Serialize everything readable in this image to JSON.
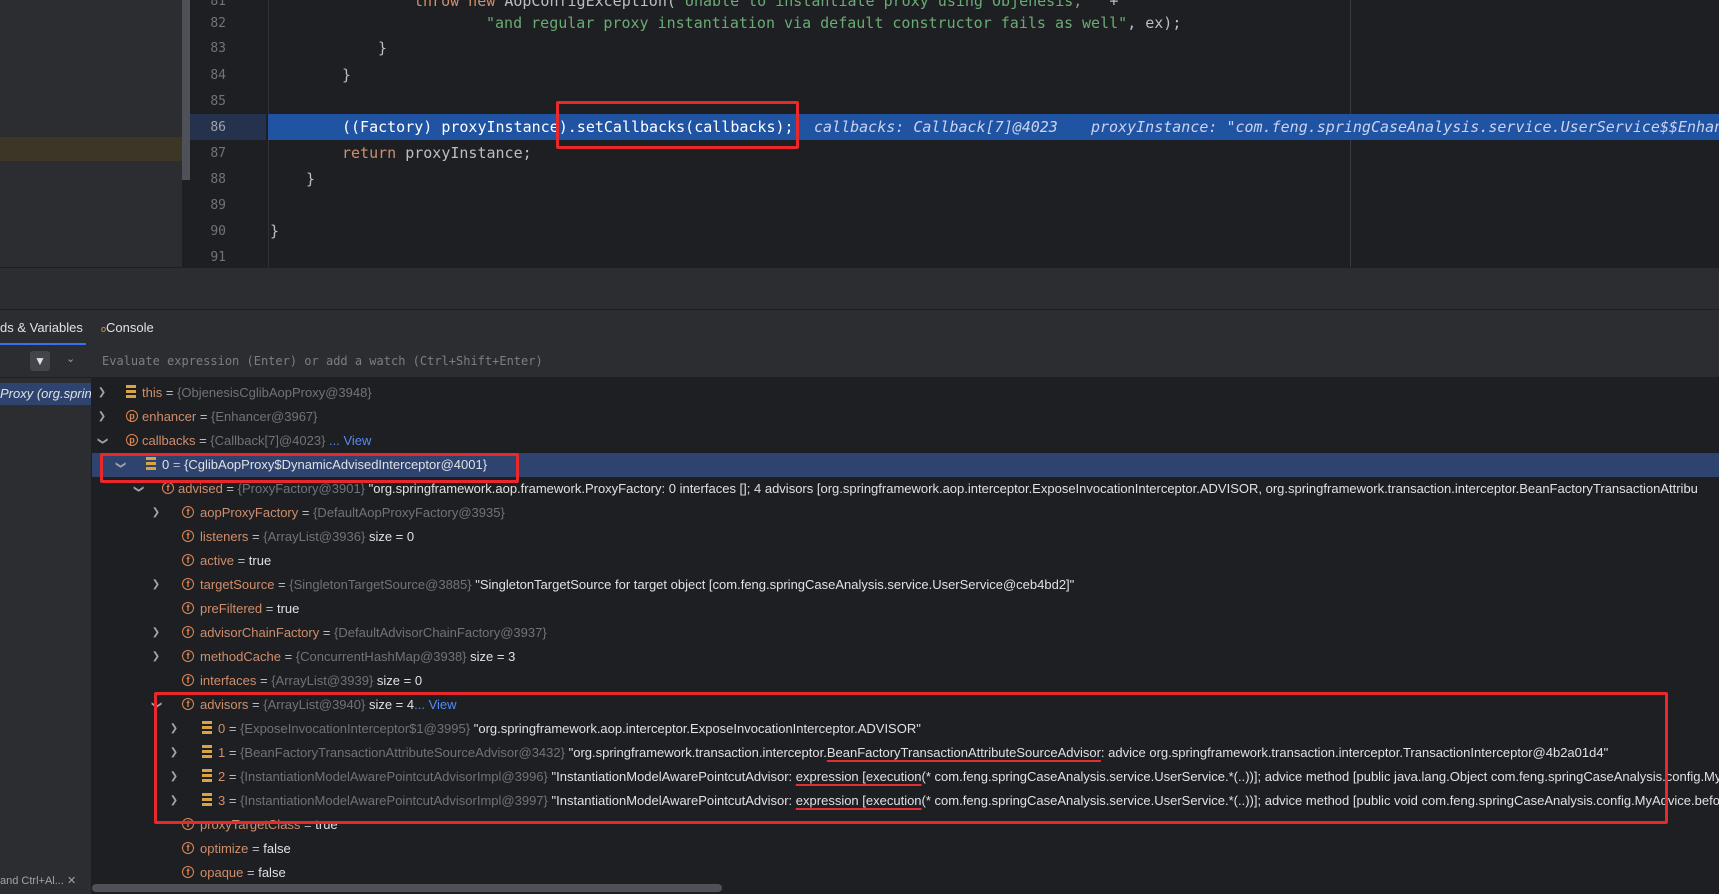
{
  "editor": {
    "lines": [
      {
        "num": "81",
        "text": "throw new AopConfigException(\"Unable to instantiate proxy using Objenesis, \" +"
      },
      {
        "num": "82",
        "text": "\"and regular proxy instantiation via default constructor fails as well\", ex);"
      },
      {
        "num": "83",
        "text": "}"
      },
      {
        "num": "84",
        "text": "}"
      },
      {
        "num": "85",
        "text": ""
      },
      {
        "num": "86",
        "text": "((Factory) proxyInstance).setCallbacks(callbacks);"
      },
      {
        "num": "87",
        "text": "return proxyInstance;"
      },
      {
        "num": "88",
        "text": "}"
      },
      {
        "num": "89",
        "text": ""
      },
      {
        "num": "90",
        "text": "}"
      },
      {
        "num": "91",
        "text": ""
      }
    ],
    "code_81_kw": "throw new ",
    "code_81_rest": "AopConfigException(",
    "code_81_str": "\"Unable to instantiate proxy using Objenesis, \"",
    "code_81_tail": " +",
    "code_82_str": "\"and regular proxy instantiation via default constructor fails as well\"",
    "code_82_tail": ", ex);",
    "code_86_a": "((Factory) proxyInstance)",
    "code_86_b": ".setCallbacks(callbacks);",
    "code_87_kw": "return",
    "code_87_rest": " proxyInstance;",
    "hint_callbacks": "callbacks: Callback[7]@4023",
    "hint_proxy": "proxyInstance: \"com.feng.springCaseAnalysis.service.UserService$$Enhan"
  },
  "tabs": {
    "threads_variables": "ds & Variables",
    "console": "Console"
  },
  "eval": {
    "filter_icon": "filter-icon",
    "placeholder": "Evaluate expression (Enter) or add a watch (Ctrl+Shift+Enter)"
  },
  "frames": {
    "selected": "Proxy (org.sprin",
    "footer": "and Ctrl+Al..."
  },
  "vars": [
    {
      "name": "this",
      "type": "{ObjenesisCglibAopProxy@3948}",
      "value": ""
    },
    {
      "name": "enhancer",
      "type": "{Enhancer@3967}",
      "value": ""
    },
    {
      "name": "callbacks",
      "type": "{Callback[7]@4023}",
      "value": "",
      "link": "... View"
    },
    {
      "name": "0",
      "type": "",
      "value": "{CglibAopProxy$DynamicAdvisedInterceptor@4001}"
    },
    {
      "name": "advised",
      "type": "{ProxyFactory@3901}",
      "value": "\"org.springframework.aop.framework.ProxyFactory: 0 interfaces []; 4 advisors [org.springframework.aop.interceptor.ExposeInvocationInterceptor.ADVISOR, org.springframework.transaction.interceptor.BeanFactoryTransactionAttribu"
    },
    {
      "name": "aopProxyFactory",
      "type": "{DefaultAopProxyFactory@3935}",
      "value": ""
    },
    {
      "name": "listeners",
      "type": "{ArrayList@3936}",
      "value": " size = 0"
    },
    {
      "name": "active",
      "type": "",
      "value": "true"
    },
    {
      "name": "targetSource",
      "type": "{SingletonTargetSource@3885}",
      "value": "\"SingletonTargetSource for target object [com.feng.springCaseAnalysis.service.UserService@ceb4bd2]\""
    },
    {
      "name": "preFiltered",
      "type": "",
      "value": "true"
    },
    {
      "name": "advisorChainFactory",
      "type": "{DefaultAdvisorChainFactory@3937}",
      "value": ""
    },
    {
      "name": "methodCache",
      "type": "{ConcurrentHashMap@3938}",
      "value": " size = 3"
    },
    {
      "name": "interfaces",
      "type": "{ArrayList@3939}",
      "value": " size = 0"
    },
    {
      "name": "advisors",
      "type": "{ArrayList@3940}",
      "value": " size = 4",
      "link": "... View"
    },
    {
      "name": "0",
      "type": "{ExposeInvocationInterceptor$1@3995}",
      "value": "\"org.springframework.aop.interceptor.ExposeInvocationInterceptor.ADVISOR\""
    },
    {
      "name": "1",
      "type": "{BeanFactoryTransactionAttributeSourceAdvisor@3432}",
      "value_a": "\"org.springframework.transaction.interceptor.",
      "value_u": "BeanFactoryTransactionAttributeSourceAdvisor",
      "value_b": ": advice org.springframework.transaction.interceptor.TransactionInterceptor@4b2a01d4\""
    },
    {
      "name": "2",
      "type": "{InstantiationModelAwarePointcutAdvisorImpl@3996}",
      "value_a": "\"InstantiationModelAwarePointcutAdvisor: ",
      "value_u": "expression [execution",
      "value_b": "(* com.feng.springCaseAnalysis.service.UserService.*(..))]; advice method [public java.lang.Object com.feng.springCaseAnalysis.config.My"
    },
    {
      "name": "3",
      "type": "{InstantiationModelAwarePointcutAdvisorImpl@3997}",
      "value_a": "\"InstantiationModelAwarePointcutAdvisor: ",
      "value_u": "expression [execution",
      "value_b": "(* com.feng.springCaseAnalysis.service.UserService.*(..))]; advice method [public void com.feng.springCaseAnalysis.config.MyAdvice.befo"
    },
    {
      "name": "proxyTargetClass",
      "type": "",
      "value": "true"
    },
    {
      "name": "optimize",
      "type": "",
      "value": "false"
    },
    {
      "name": "opaque",
      "type": "",
      "value": "false"
    }
  ],
  "colors": {
    "accent": "#3574f0",
    "annotation_red": "#e8282b",
    "exec_line": "#2153a3",
    "field_name": "#cf8e6d"
  }
}
